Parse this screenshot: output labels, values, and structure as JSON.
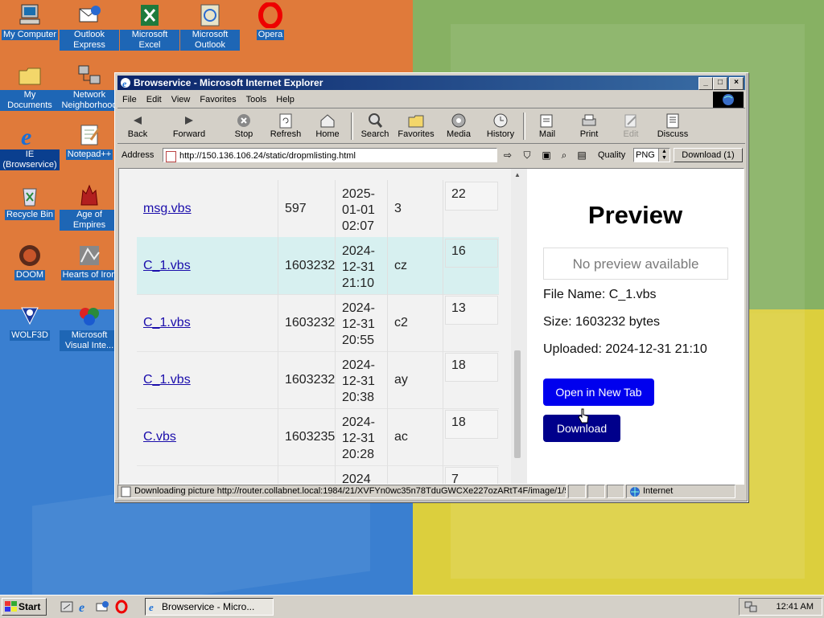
{
  "desktop": {
    "icons": [
      {
        "label": "My Computer"
      },
      {
        "label": "Outlook Express"
      },
      {
        "label": "Microsoft Excel"
      },
      {
        "label": "Microsoft Outlook"
      },
      {
        "label": "Opera"
      },
      {
        "label": "My Documents"
      },
      {
        "label": "Network Neighborhood"
      },
      {
        "label": "IE (Browservice)"
      },
      {
        "label": "Notepad++"
      },
      {
        "label": "Recycle Bin"
      },
      {
        "label": "Age of Empires"
      },
      {
        "label": "DOOM"
      },
      {
        "label": "Hearts of Iron"
      },
      {
        "label": "WOLF3D"
      },
      {
        "label": "Microsoft Visual Inte..."
      }
    ]
  },
  "window": {
    "title": "Browservice - Microsoft Internet Explorer",
    "menu": [
      "File",
      "Edit",
      "View",
      "Favorites",
      "Tools",
      "Help"
    ],
    "toolbar": {
      "back": "Back",
      "forward": "Forward",
      "stop": "Stop",
      "refresh": "Refresh",
      "home": "Home",
      "search": "Search",
      "favorites": "Favorites",
      "media": "Media",
      "history": "History",
      "mail": "Mail",
      "print": "Print",
      "edit": "Edit",
      "discuss": "Discuss"
    },
    "address": {
      "label": "Address",
      "url": "http://150.136.106.24/static/dropmlisting.html",
      "quality_label": "Quality",
      "quality_value": "PNG",
      "download_button": "Download (1)"
    },
    "status": {
      "text": "Downloading picture http://router.collabnet.local:1984/21/XVFYn0wc35n78TduGWCXe227ozARtT4F/image/1/5(",
      "zone": "Internet"
    }
  },
  "page": {
    "rows": [
      {
        "name": "msg.vbs",
        "size": "597",
        "date1": "2025-",
        "date2": "01-01",
        "date3": "02:07",
        "tag": "3",
        "num": "22",
        "highlight": false
      },
      {
        "name": "C_1.vbs",
        "size": "1603232",
        "date1": "2024-",
        "date2": "12-31",
        "date3": "21:10",
        "tag": "cz",
        "num": "16",
        "highlight": true
      },
      {
        "name": "C_1.vbs",
        "size": "1603232",
        "date1": "2024-",
        "date2": "12-31",
        "date3": "20:55",
        "tag": "c2",
        "num": "13",
        "highlight": false
      },
      {
        "name": "C_1.vbs",
        "size": "1603232",
        "date1": "2024-",
        "date2": "12-31",
        "date3": "20:38",
        "tag": "ay",
        "num": "18",
        "highlight": false
      },
      {
        "name": "C.vbs",
        "size": "1603235",
        "date1": "2024-",
        "date2": "12-31",
        "date3": "20:28",
        "tag": "ac",
        "num": "18",
        "highlight": false
      },
      {
        "name": "",
        "size": "",
        "date1": "2024",
        "date2": "",
        "date3": "",
        "tag": "",
        "num": "7",
        "highlight": false
      }
    ],
    "preview": {
      "title": "Preview",
      "no_preview": "No preview available",
      "file_name": "File Name: C_1.vbs",
      "size": "Size: 1603232 bytes",
      "uploaded": "Uploaded: 2024-12-31 21:10",
      "open_button": "Open in New Tab",
      "download_button": "Download"
    }
  },
  "taskbar": {
    "start": "Start",
    "task": "Browservice - Micro...",
    "clock": "12:41 AM"
  },
  "colors": {
    "title_gradient_start": "#0a246a",
    "title_gradient_end": "#3a6ea5",
    "link": "#1a0dab",
    "row_highlight": "#d7f0f0",
    "open_button": "#0000ee",
    "download_button": "#00008b"
  }
}
